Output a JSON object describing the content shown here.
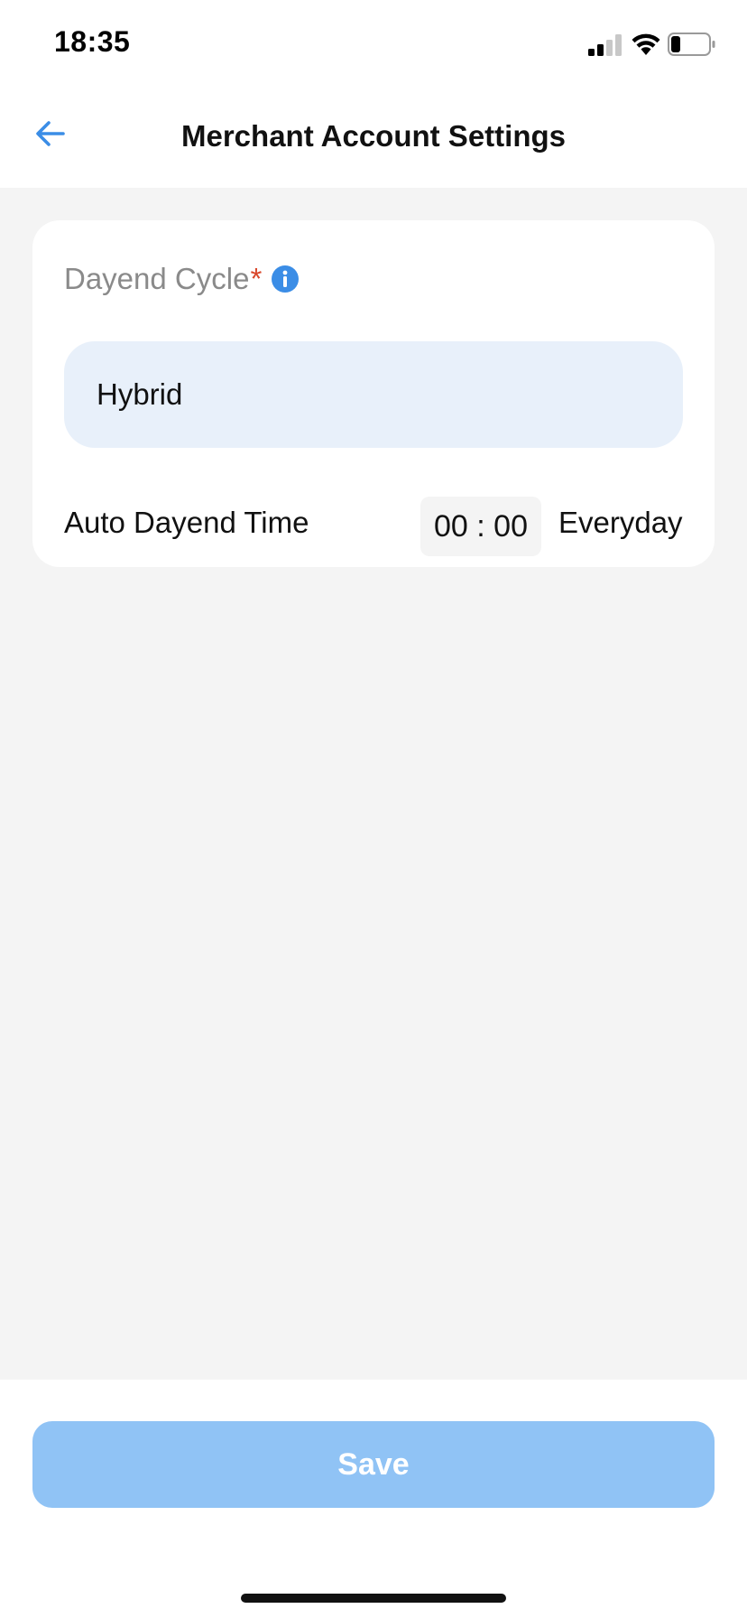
{
  "status_bar": {
    "time": "18:35"
  },
  "nav": {
    "title": "Merchant Account Settings"
  },
  "form": {
    "dayend_cycle_label": "Dayend Cycle",
    "required_mark": "*",
    "dayend_cycle_value": "Hybrid",
    "auto_dayend_label": "Auto Dayend Time",
    "auto_dayend_time": "00 : 00",
    "auto_dayend_frequency": "Everyday"
  },
  "footer": {
    "save_label": "Save"
  },
  "colors": {
    "accent": "#3b8de6",
    "save_disabled": "#90c3f5",
    "select_bg": "#e8f0fa",
    "required": "#d9472b",
    "page_bg": "#f4f4f4"
  },
  "icons": {
    "back": "arrow-left-icon",
    "info": "info-icon"
  }
}
